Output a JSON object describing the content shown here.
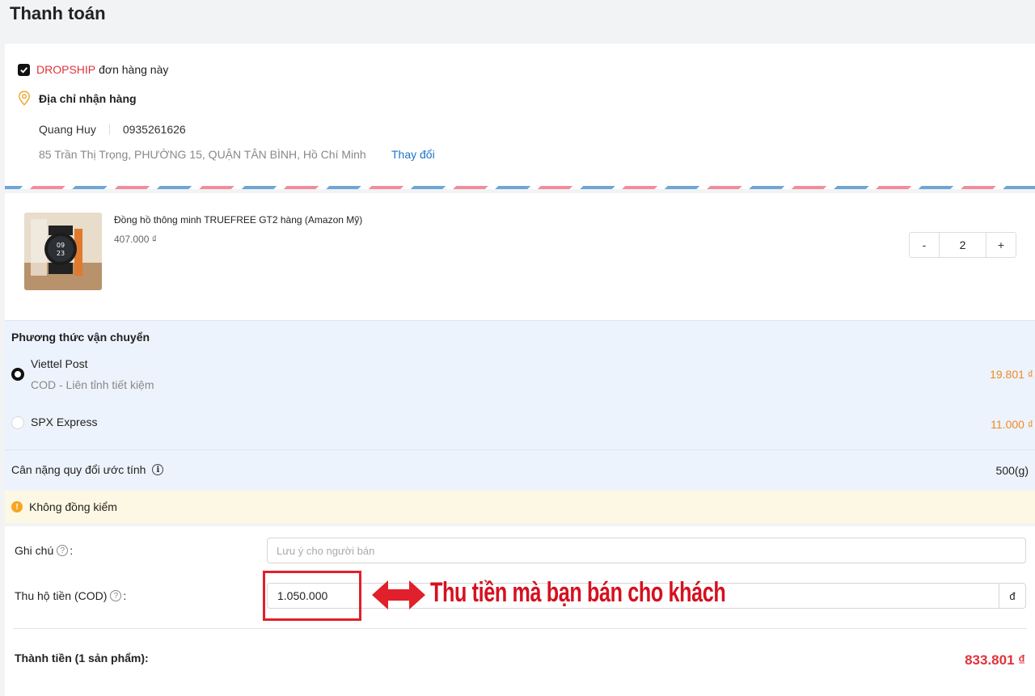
{
  "page": {
    "title": "Thanh toán"
  },
  "dropship": {
    "highlight": "DROPSHIP",
    "text": "đơn hàng này",
    "checked": true
  },
  "address": {
    "title": "Địa chỉ nhận hàng",
    "name": "Quang Huy",
    "phone": "0935261626",
    "line": "85 Trần Thị Trọng, PHƯỜNG 15, QUẬN TÂN BÌNH, Hồ Chí Minh",
    "change_label": "Thay đổi"
  },
  "product": {
    "name": "Đồng hồ thông minh TRUEFREE GT2 hàng (Amazon Mỹ)",
    "price": "407.000 ₫",
    "quantity": "2",
    "minus": "-",
    "plus": "+"
  },
  "shipping": {
    "title": "Phương thức vận chuyển",
    "options": [
      {
        "name": "Viettel Post",
        "sub": "COD - Liên tỉnh tiết kiệm",
        "price": "19.801 ₫",
        "selected": true
      },
      {
        "name": "SPX Express",
        "sub": "",
        "price": "11.000 ₫",
        "selected": false
      }
    ]
  },
  "weight": {
    "label": "Cân nặng quy đổi ước tính",
    "value": "500(g)"
  },
  "warning": {
    "text": "Không đồng kiểm"
  },
  "form": {
    "note_label": "Ghi chú",
    "note_placeholder": "Lưu ý cho người bán",
    "cod_label": "Thu hộ tiền (COD)",
    "cod_value": "1.050.000",
    "cod_unit": "đ",
    "colon": ":"
  },
  "annotation": {
    "text": "Thu tiền mà bạn bán cho khách"
  },
  "total": {
    "label": "Thành tiền (1 sản phẩm):",
    "value": "833.801 ₫"
  },
  "colors": {
    "accent_red": "#e0333a",
    "link_blue": "#1a73c9",
    "price_orange": "#ee8a21",
    "annotation_red": "#d6101f"
  }
}
